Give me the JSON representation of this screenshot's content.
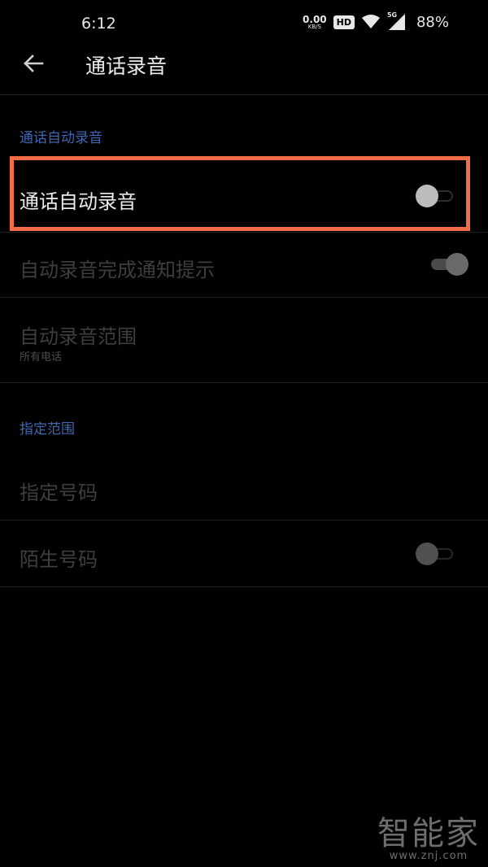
{
  "status_bar": {
    "time": "6:12",
    "net_speed_value": "0.00",
    "net_speed_unit": "KB/S",
    "hd": "HD",
    "signal_label": "5G",
    "battery": "88%"
  },
  "header": {
    "title": "通话录音"
  },
  "sections": {
    "auto_record": {
      "title": "通话自动录音",
      "toggle_row": {
        "label": "通话自动录音",
        "checked": false
      },
      "notify_row": {
        "label": "自动录音完成通知提示",
        "checked": true
      },
      "range_row": {
        "label": "自动录音范围",
        "value": "所有电话"
      }
    },
    "specified": {
      "title": "指定范围",
      "numbers_row": {
        "label": "指定号码"
      },
      "unknown_row": {
        "label": "陌生号码",
        "checked": false
      }
    }
  },
  "watermark": {
    "main": "智能家",
    "sub": "www.znj.com"
  }
}
